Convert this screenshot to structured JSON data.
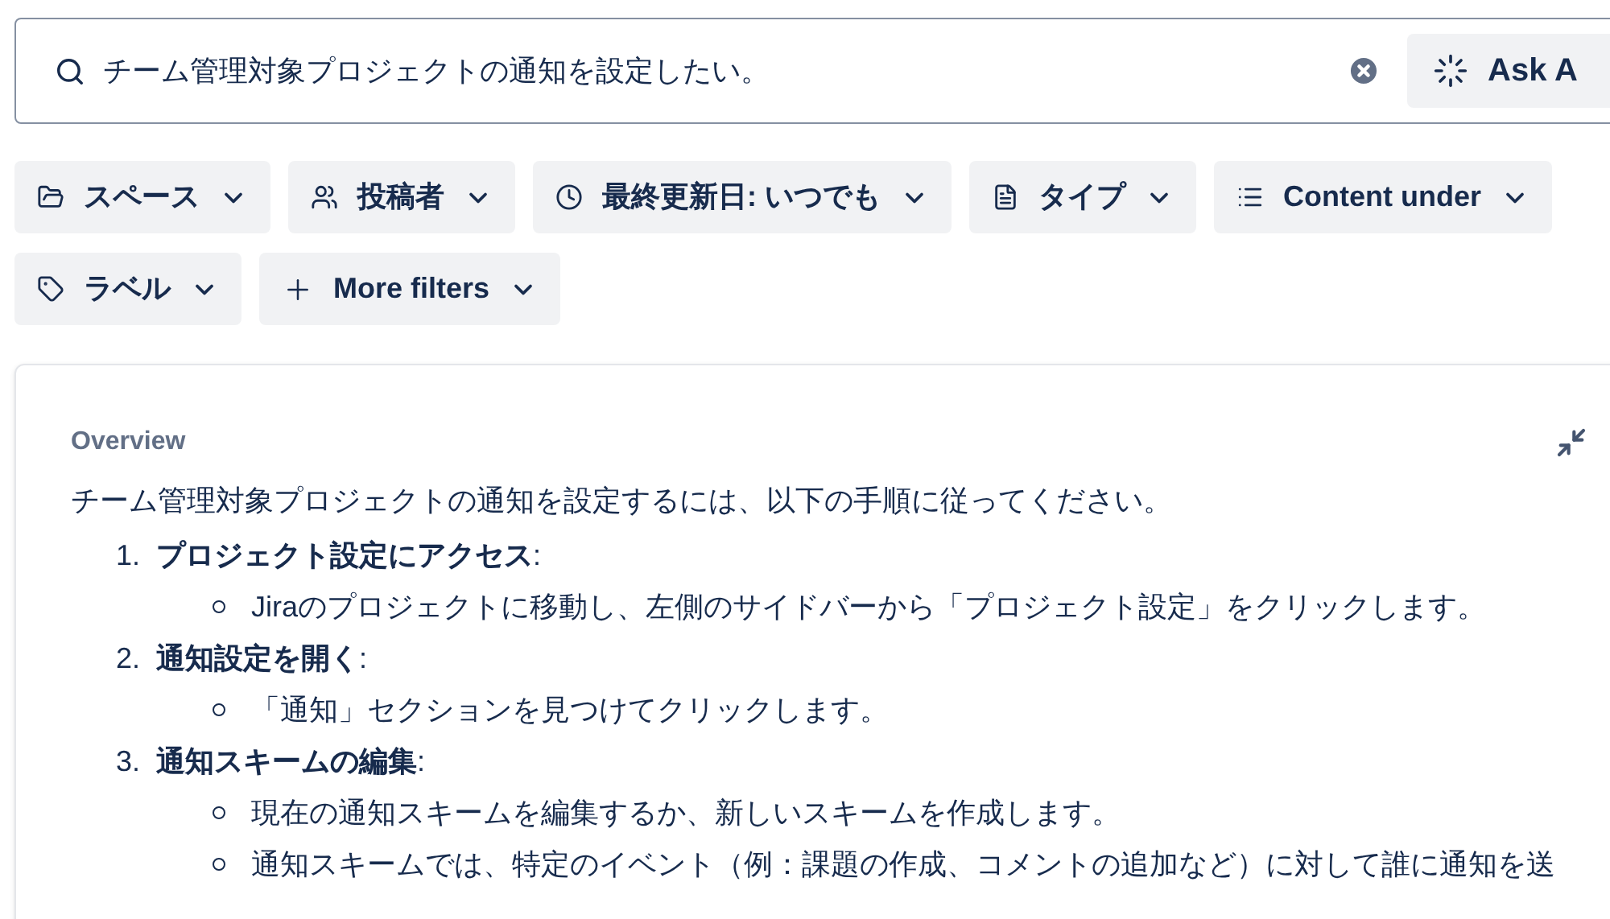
{
  "search": {
    "value": "チーム管理対象プロジェクトの通知を設定したい。",
    "ask_button": "Ask A"
  },
  "filters": [
    {
      "label": "スペース",
      "kind": "folder"
    },
    {
      "label": "投稿者",
      "kind": "people"
    },
    {
      "label": "最終更新日: いつでも",
      "kind": "clock"
    },
    {
      "label": "タイプ",
      "kind": "document"
    },
    {
      "label": "Content under",
      "kind": "list"
    },
    {
      "label": "ラベル",
      "kind": "tag"
    },
    {
      "label": "More filters",
      "kind": "plus"
    }
  ],
  "overview": {
    "title": "Overview",
    "intro": "チーム管理対象プロジェクトの通知を設定するには、以下の手順に従ってください。",
    "steps": [
      {
        "number": "1.",
        "title": "**プロジェクト設定にアクセス**:",
        "substeps": [
          "Jiraのプロジェクトに移動し、左側のサイドバーから「プロジェクト設定」をクリックします。"
        ]
      },
      {
        "number": "2.",
        "title": "**通知設定を開く**:",
        "substeps": [
          "「通知」セクションを見つけてクリックします。"
        ]
      },
      {
        "number": "3.",
        "title": "**通知スキームの編集**:",
        "substeps": [
          "現在の通知スキームを編集するか、新しいスキームを作成します。",
          "通知スキームでは、特定のイベント（例：課題の作成、コメントの追加など）に対して誰に通知を送"
        ]
      }
    ]
  }
}
